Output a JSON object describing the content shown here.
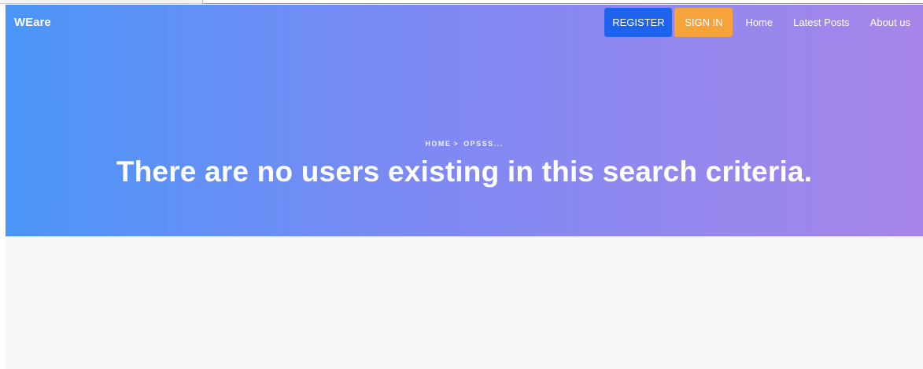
{
  "header": {
    "brand": "WEare",
    "register_label": "REGISTER",
    "signin_label": "SIGN IN",
    "nav_links": [
      "Home",
      "Latest Posts",
      "About us"
    ]
  },
  "hero": {
    "breadcrumb": {
      "home": "HOME",
      "separator": ">",
      "current": "OPSSS..."
    },
    "headline": "There are no users existing in this search criteria."
  },
  "colors": {
    "gradient_start": "#4b96f7",
    "gradient_end": "#a685e8",
    "register_button": "#1d63ee",
    "signin_button": "#f5a33a"
  }
}
